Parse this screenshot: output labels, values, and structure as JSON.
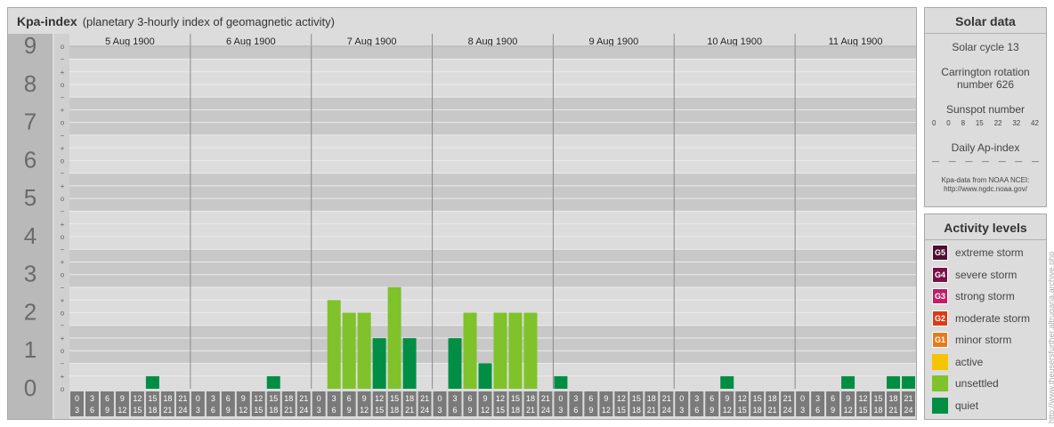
{
  "header": {
    "title": "Kpa-index",
    "subtitle": "(planetary 3-hourly index of geomagnetic activity)"
  },
  "chart_data": {
    "type": "bar",
    "y_major_labels": [
      "0",
      "1",
      "2",
      "3",
      "4",
      "5",
      "6",
      "7",
      "8",
      "9"
    ],
    "y_minor_labels": [
      "o",
      "+",
      "−"
    ],
    "ylim": [
      0,
      9.33
    ],
    "days": [
      {
        "label": "5 Aug 1900",
        "kp": [
          0,
          0,
          0,
          0,
          0,
          0.33,
          0,
          0
        ]
      },
      {
        "label": "6 Aug 1900",
        "kp": [
          0,
          0,
          0,
          0,
          0,
          0.33,
          0,
          0
        ]
      },
      {
        "label": "7 Aug 1900",
        "kp": [
          0,
          2.33,
          2,
          2,
          1.33,
          2.67,
          1.33,
          0
        ]
      },
      {
        "label": "8 Aug 1900",
        "kp": [
          0,
          1.33,
          2,
          0.67,
          2,
          2,
          2,
          0
        ]
      },
      {
        "label": "9 Aug 1900",
        "kp": [
          0.33,
          0,
          0,
          0,
          0,
          0,
          0,
          0
        ]
      },
      {
        "label": "10 Aug 1900",
        "kp": [
          0,
          0,
          0,
          0.33,
          0,
          0,
          0,
          0
        ]
      },
      {
        "label": "11 Aug 1900",
        "kp": [
          0,
          0,
          0,
          0.33,
          0,
          0,
          0.33,
          0.33
        ]
      }
    ],
    "interval_start_labels": [
      "0",
      "3",
      "6",
      "9",
      "12",
      "15",
      "18",
      "21"
    ],
    "interval_end_labels": [
      "3",
      "6",
      "9",
      "12",
      "15",
      "18",
      "21",
      "24"
    ]
  },
  "solar": {
    "title": "Solar data",
    "cycle": "Solar cycle 13",
    "carrington_line1": "Carrington rotation",
    "carrington_line2": "number 626",
    "sunspot_title": "Sunspot number",
    "sunspot_values": [
      "0",
      "0",
      "8",
      "15",
      "22",
      "32",
      "42"
    ],
    "ap_title": "Daily Ap-index",
    "ap_values": [
      "—",
      "—",
      "—",
      "—",
      "—",
      "—",
      "—"
    ],
    "source_line1": "Kpa-data from NOAA NCEI:",
    "source_line2": "http://www.ngdc.noaa.gov/"
  },
  "levels": {
    "title": "Activity levels",
    "items": [
      {
        "badge": "G5",
        "label": "extreme storm",
        "color": "#4d0f30"
      },
      {
        "badge": "G4",
        "label": "severe storm",
        "color": "#7a1046"
      },
      {
        "badge": "G3",
        "label": "strong storm",
        "color": "#c01e6a"
      },
      {
        "badge": "G2",
        "label": "moderate storm",
        "color": "#de3a16"
      },
      {
        "badge": "G1",
        "label": "minor storm",
        "color": "#e77a1a"
      },
      {
        "badge": "",
        "label": "active",
        "color": "#f6c400"
      },
      {
        "badge": "",
        "label": "unsettled",
        "color": "#7fc22a"
      },
      {
        "badge": "",
        "label": "quiet",
        "color": "#008e44"
      }
    ]
  },
  "credit": "http://www.theusersfurther.altrugaria.archive.php"
}
